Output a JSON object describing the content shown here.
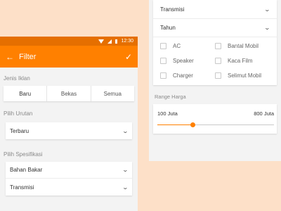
{
  "statusbar": {
    "time": "12:30"
  },
  "appbar": {
    "title": "Filter",
    "back_icon": "arrow-left-icon",
    "confirm_icon": "check-icon"
  },
  "jenis_iklan": {
    "label": "Jenis Iklan",
    "options": [
      "Baru",
      "Bekas",
      "Semua"
    ],
    "selected": "Baru"
  },
  "urutan": {
    "label": "Pilih Urutan",
    "value": "Terbaru"
  },
  "spesifikasi": {
    "label": "Pilih Spesifikasi",
    "items": [
      "Bahan Bakar",
      "Transmisi"
    ]
  },
  "right_panel": {
    "dropdowns": [
      "Transmisi",
      "Tahun"
    ],
    "features": [
      "AC",
      "Bantal Mobil",
      "Speaker",
      "Kaca Film",
      "Charger",
      "Selimut Mobil"
    ],
    "range": {
      "label": "Range Harga",
      "min_label": "100 Juta",
      "max_label": "800 Juta",
      "value_fraction": 0.3
    }
  },
  "colors": {
    "accent": "#ff8000",
    "statusbar": "#e56f00",
    "background": "#fde0c8"
  }
}
